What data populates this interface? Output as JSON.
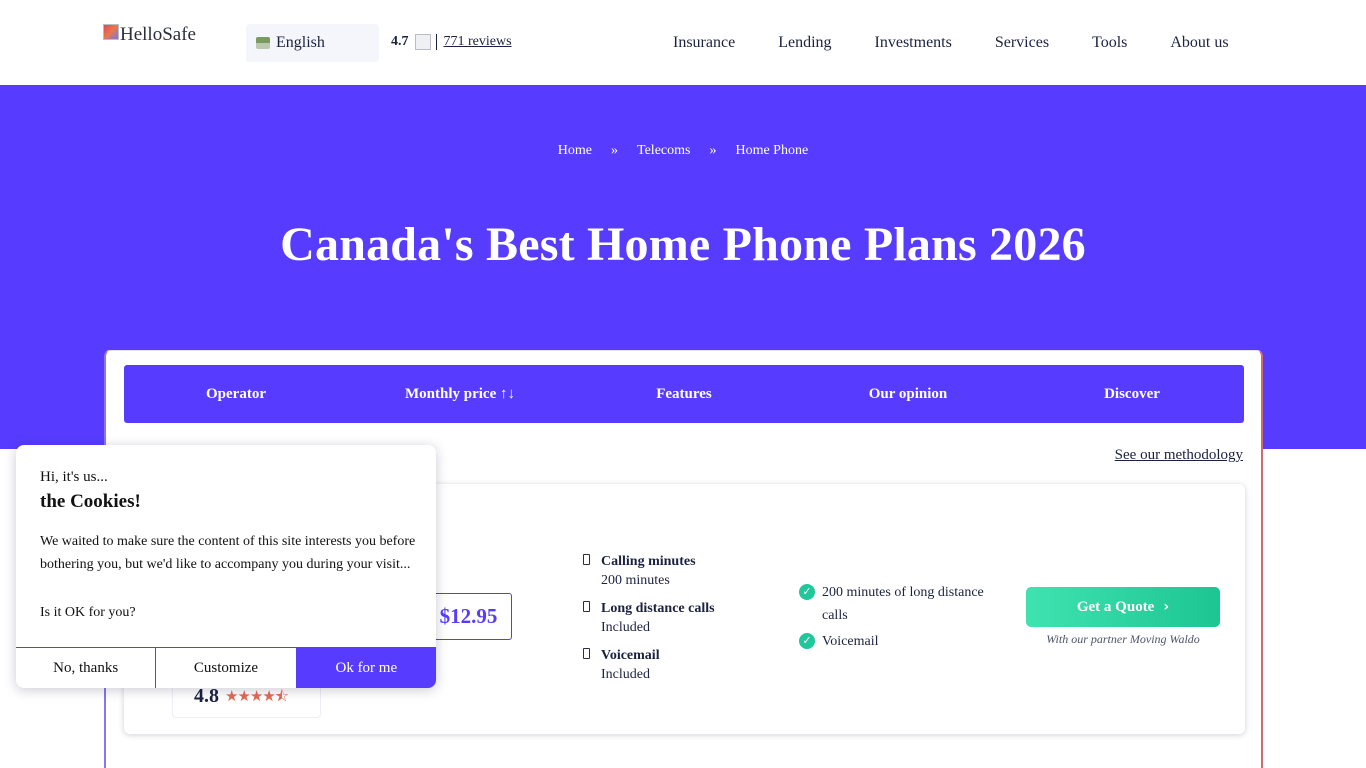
{
  "header": {
    "logo_alt": "HelloSafe",
    "language": "English",
    "rating": "4.7",
    "reviews_link": "771 reviews",
    "nav": [
      "Insurance",
      "Lending",
      "Investments",
      "Services",
      "Tools",
      "About us"
    ]
  },
  "hero": {
    "breadcrumb": [
      "Home",
      "Telecoms",
      "Home Phone"
    ],
    "breadcrumb_separator": "»",
    "title": "Canada's Best Home Phone Plans 2026"
  },
  "table": {
    "columns": [
      "Operator",
      "Monthly price ↑↓",
      "Features",
      "Our opinion",
      "Discover"
    ],
    "methodology_link": "See our methodology",
    "row": {
      "price": "$12.95",
      "rating": "4.8",
      "stars": "★★★★⯪",
      "features": [
        {
          "title": "Calling minutes",
          "value": "200 minutes"
        },
        {
          "title": "Long distance calls",
          "value": "Included"
        },
        {
          "title": "Voicemail",
          "value": "Included"
        }
      ],
      "opinion": [
        "200 minutes of long distance calls",
        "Voicemail"
      ],
      "cta_label": "Get a Quote",
      "partner_note": "With our partner Moving Waldo"
    }
  },
  "cookie_banner": {
    "greeting": "Hi, it's us...",
    "title": "the Cookies!",
    "body": "We waited to make sure the content of this site interests you before bothering you, but we'd like to accompany you during your visit...",
    "question": "Is it OK for you?",
    "buttons": {
      "decline": "No, thanks",
      "customize": "Customize",
      "accept": "Ok for me"
    }
  },
  "colors": {
    "brand_purple": "#573cff",
    "cta_green": "#1fc79b",
    "star_orange": "#e46a54"
  }
}
